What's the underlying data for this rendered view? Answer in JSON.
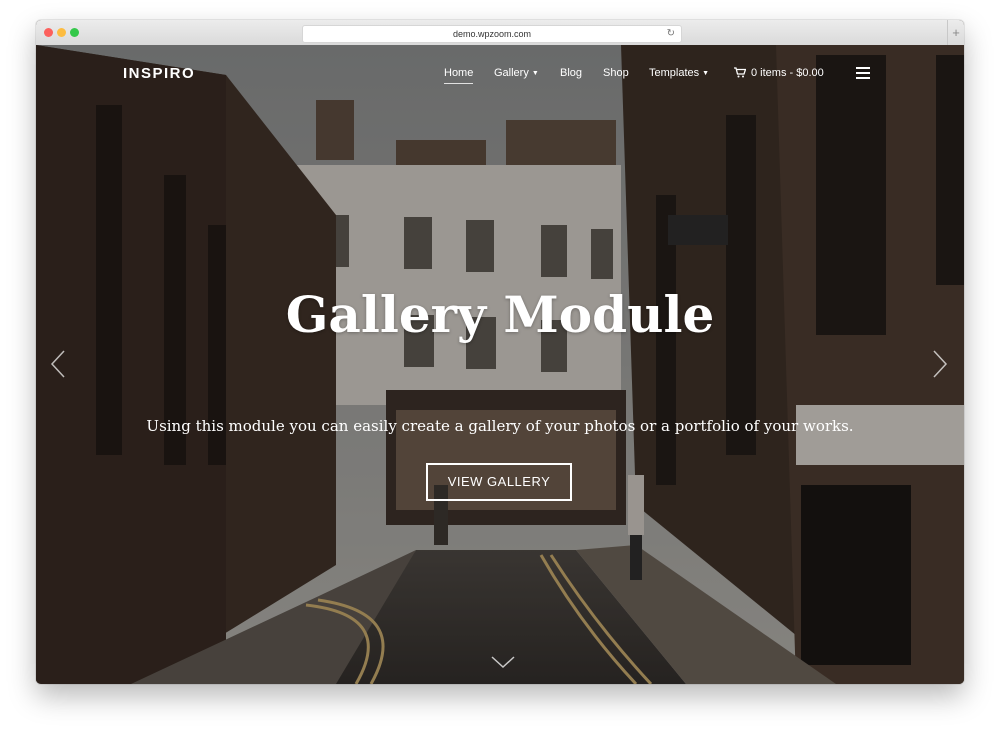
{
  "browser": {
    "url": "demo.wpzoom.com",
    "reload_icon": "reload-icon",
    "new_tab_label": "+"
  },
  "site": {
    "logo": "INSPIRO",
    "nav": {
      "home": "Home",
      "gallery": "Gallery",
      "blog": "Blog",
      "shop": "Shop",
      "templates": "Templates",
      "cart": "0 items - $0.00"
    },
    "icons": {
      "caret": "chevron-down-icon",
      "cart": "cart-icon",
      "menu": "hamburger-menu-icon"
    }
  },
  "hero": {
    "title": "Gallery Module",
    "subtitle": "Using this module you can easily create a gallery of your photos or a portfolio of your works.",
    "cta_label": "VIEW GALLERY",
    "icons": {
      "prev": "chevron-left-icon",
      "next": "chevron-right-icon",
      "scroll": "chevron-down-icon"
    }
  },
  "colors": {
    "overlay": "#0f0c0a",
    "text": "#ffffff"
  }
}
